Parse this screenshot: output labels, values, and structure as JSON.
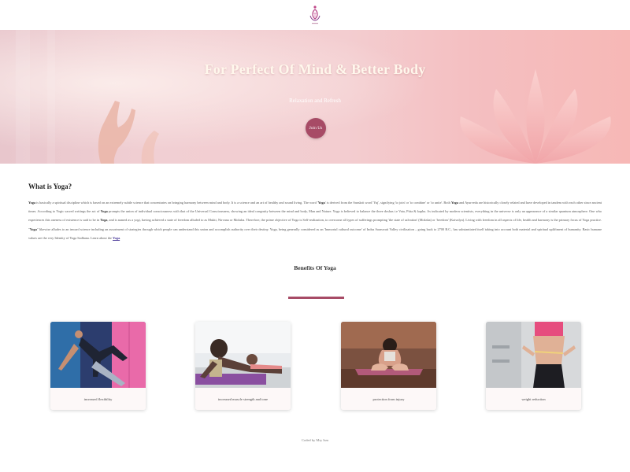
{
  "header": {
    "logo_icon": "lotus-logo-icon"
  },
  "hero": {
    "title": "For Perfect Of Mind & Better Body",
    "subtitle": "Relaxation and Refresh",
    "button_label": "Join Us"
  },
  "about": {
    "title": "What is Yoga?",
    "p1_bold1": "Yoga",
    "p1_a": " is basically a spiritual discipline which is based on an extremely subtle science that concentrates on bringing harmony between mind and body. It is a science and an art of healthy and sound living. The word '",
    "p1_bold2": "Yoga",
    "p1_b": "' is derived from the Sanskrit word 'Yuj', signifying 'to join' or 'to combine' or 'to unite'. Both ",
    "p1_bold3": "Yoga",
    "p1_c": " and Ayurveda are historically closely related and have developed in tandem with each other since ancient times. According to Yogic sacred writings the act of ",
    "p1_bold4": "Yoga",
    "p1_d": " prompts the union of individual consciousness with that of the Universal Consciousness, showing an ideal congruity between the mind and body, Man and Nature. Yoga is believed to balance the three doshas i.e Vata, Pitta & kapha. As indicated by modern scientists, everything in the universe is only an appearance of a similar quantum atmosphere. One who experiences this oneness of existence is said to be in ",
    "p1_bold5": "Yoga",
    "p1_e": ", and is named as a yogi, having achieved a state of freedom alluded to as Mukti, Nirvana or Moksha. Therefore, the prime objective of Yoga is Self-realization, to overcome all types of sufferings prompting 'the state of salvation' (Moksha) or 'freedom' (Kaivalya). Living with freedom in all aspects of life, health and harmony is the primary focus of Yoga practice. \"",
    "p1_bold6": "Yoga",
    "p1_f": "\" likewise alludes to an inward science including an assortment of strategies through which people can understand this union and accomplish authority over their destiny. Yoga, being generally considered as an 'Immortal cultural outcome' of Indus Saraswati Valley civilization – going back to 2700 B.C., has substantiated itself taking into account both material and spiritual upliftment of humanity. Basic humane values are the very Identity of Yoga Sadhana. Learn about the ",
    "link_label": "Yoga",
    "p1_end": "."
  },
  "benefits": {
    "title": "Benefits Of Yoga",
    "cards": [
      {
        "caption": "increased flexibility"
      },
      {
        "caption": "increased muscle strength and tone"
      },
      {
        "caption": "protection from injury"
      },
      {
        "caption": "weight reduction"
      }
    ]
  },
  "footer": {
    "text": "Coded by Mry Ism"
  },
  "colors": {
    "accent": "#a74b66",
    "hero_pink": "#f3cdd0"
  }
}
